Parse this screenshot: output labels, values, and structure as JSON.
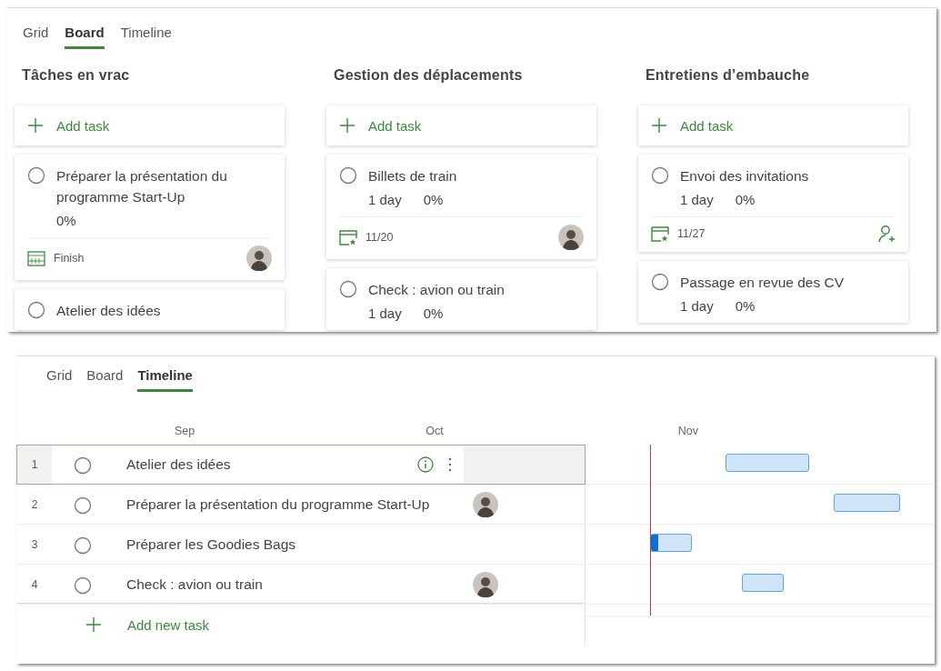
{
  "board_view": {
    "tabs": [
      {
        "label": "Grid",
        "selected": false
      },
      {
        "label": "Board",
        "selected": true
      },
      {
        "label": "Timeline",
        "selected": false
      }
    ],
    "buckets": [
      {
        "title": "Tâches en vrac",
        "add_label": "Add task",
        "cards": [
          {
            "name": "Préparer la présentation du programme Start-Up",
            "completed": false,
            "progress": "0%",
            "footer": {
              "kind": "finish",
              "date": "Finish",
              "assigned": true
            }
          },
          {
            "name": "Atelier des idées",
            "completed": false
          }
        ]
      },
      {
        "title": "Gestion des déplacements",
        "add_label": "Add task",
        "cards": [
          {
            "name": "Billets de train",
            "completed": false,
            "duration": "1 day",
            "progress": "0%",
            "footer": {
              "kind": "due",
              "date": "11/20",
              "assigned": true
            }
          },
          {
            "name": "Check : avion ou train",
            "completed": false,
            "duration": "1 day",
            "progress": "0%"
          }
        ]
      },
      {
        "title": "Entretiens d’embauche",
        "add_label": "Add task",
        "cards": [
          {
            "name": "Envoi des invitations",
            "completed": false,
            "duration": "1 day",
            "progress": "0%",
            "footer": {
              "kind": "due",
              "date": "11/27",
              "assigned": false
            }
          },
          {
            "name": "Passage en revue des CV",
            "completed": false,
            "duration": "1 day",
            "progress": "0%"
          }
        ]
      }
    ]
  },
  "timeline_view": {
    "tabs": [
      {
        "label": "Grid",
        "selected": false
      },
      {
        "label": "Board",
        "selected": false
      },
      {
        "label": "Timeline",
        "selected": true
      }
    ],
    "months": [
      "Sep",
      "Oct",
      "Nov"
    ],
    "tasks": [
      {
        "number": "1",
        "name": "Atelier des idées",
        "completed": false,
        "selected": true,
        "assignee": false,
        "level": 0
      },
      {
        "number": "2",
        "name": "Préparer la présentation du programme Start-Up",
        "completed": false,
        "selected": false,
        "assignee": true,
        "level": 0
      },
      {
        "number": "3",
        "name": "Préparer les Goodies Bags",
        "completed": false,
        "selected": false,
        "assignee": false,
        "level": 0.18
      },
      {
        "number": "4",
        "name": "Check : avion ou train",
        "completed": false,
        "selected": false,
        "assignee": true,
        "level": 0
      }
    ],
    "add_label": "Add new task"
  }
}
